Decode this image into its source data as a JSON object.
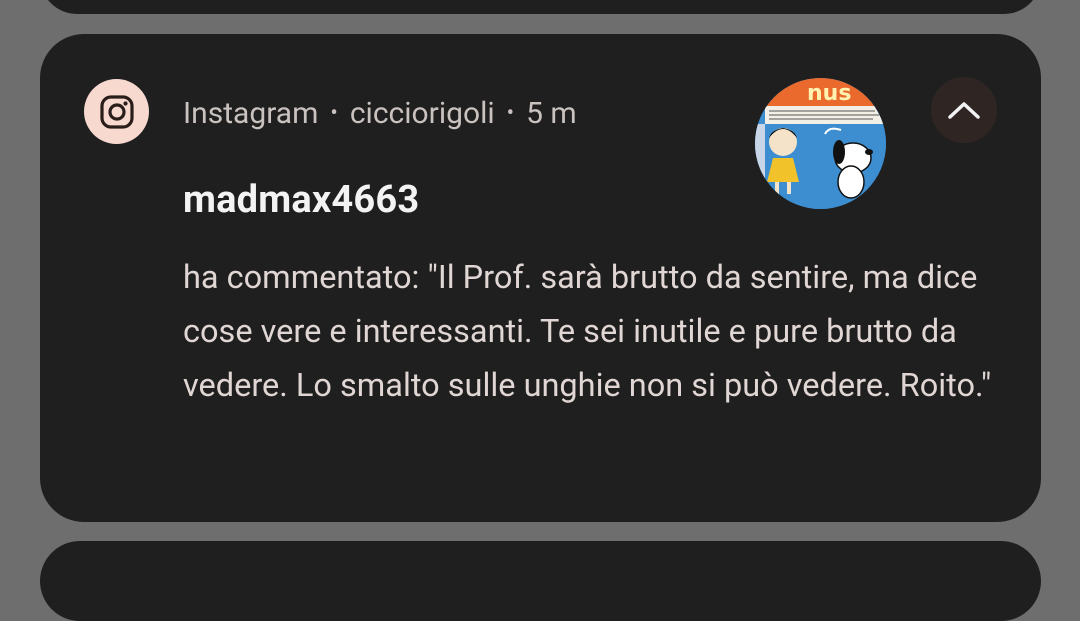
{
  "notification": {
    "app_name": "Instagram",
    "separator": "•",
    "account": "cicciorigoli",
    "time_ago": "5 m",
    "title": "madmax4663",
    "body": "ha commentato: \"Il Prof. sarà brutto da sentire, ma dice cose vere e interessanti. Te sei inutile e pure brutto da vedere. Lo smalto sulle unghie non si può vedere. Roito.\"",
    "app_icon": "instagram-icon",
    "expand_icon": "chevron-up-icon",
    "thumbnail": "peanuts-comic-avatar"
  },
  "colors": {
    "background": "#6e6e6e",
    "card": "#1f1f1f",
    "icon_bg": "#f8d9cf",
    "title_text": "#f3f3f3",
    "body_text": "#e0d6d3",
    "meta_text": "#c9c2bf"
  }
}
